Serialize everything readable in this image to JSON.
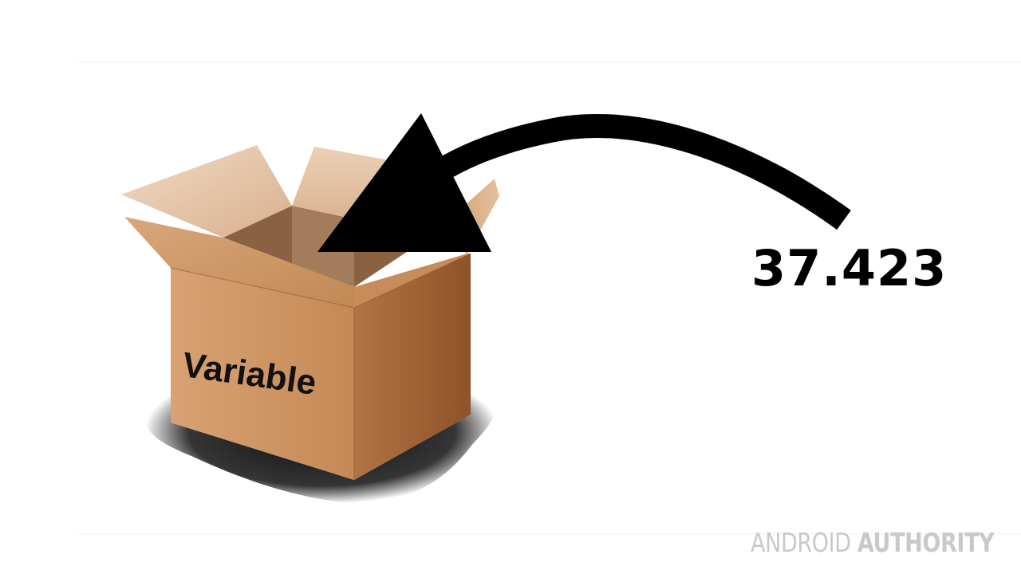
{
  "diagram": {
    "box_label": "Variable",
    "value": "37.423"
  },
  "watermark": {
    "part1": "ANDROID",
    "part2": "AUTHORITY"
  },
  "icons": {
    "box": "cardboard-box-icon",
    "arrow": "curved-arrow-icon"
  },
  "colors": {
    "background": "#ffffff",
    "arrow": "#000000",
    "box_front": "#c98f5c",
    "box_side": "#9c6235",
    "watermark": "#c9c9c9"
  }
}
